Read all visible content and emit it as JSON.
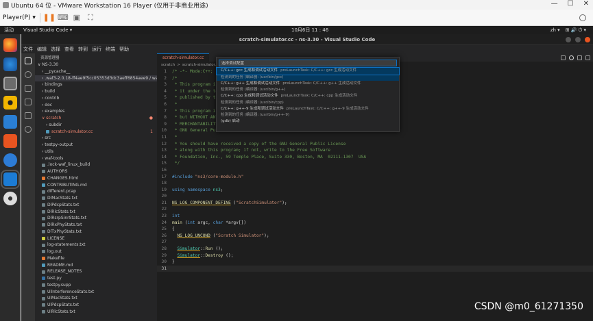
{
  "vm": {
    "title": "Ubuntu 64 位 - VMware Workstation 16 Player (仅用于非商业用途)",
    "player_menu": "Player(P) ▾",
    "minimize": "—",
    "maximize": "☐",
    "close": "✕"
  },
  "ubuntu": {
    "activities": "活动",
    "app_name": "Visual Studio Code ▾",
    "clock": "10月6日 11 : 46",
    "lang": "zh ▾",
    "sys_icons": "⊞ 🔊 ⏻ ▾"
  },
  "dock": [
    "firefox-icon",
    "thunderbird-icon",
    "files-icon",
    "rhythmbox-icon",
    "writer-icon",
    "software-icon",
    "help-icon",
    "vscode-icon",
    "disc-icon"
  ],
  "vscode": {
    "title": "scratch-simulator.cc - ns-3.30 - Visual Studio Code",
    "menu": [
      "文件",
      "编辑",
      "选择",
      "查看",
      "转到",
      "运行",
      "终端",
      "帮助"
    ],
    "explorer_header": "资源管理器",
    "tab_label": "scratch-simulator.cc",
    "breadcrumb": [
      "scratch",
      ">",
      "scratch-simulator.cc"
    ],
    "tree": [
      {
        "label": "∨ NS-3.30",
        "indent": 0,
        "color": "#cccccc",
        "icon": "",
        "mark": ""
      },
      {
        "label": "› __pycache__",
        "indent": 6,
        "color": "#cccccc",
        "icon": "",
        "mark": ""
      },
      {
        "label": "› .waf3-2.0.18-ff4ae9f5cc05353d3dc3aeff6854aee9 / waflib",
        "indent": 6,
        "color": "#cccccc",
        "icon": "",
        "mark": "",
        "selected": true
      },
      {
        "label": "› bindings",
        "indent": 6,
        "color": "#cccccc",
        "icon": "",
        "mark": ""
      },
      {
        "label": "› build",
        "indent": 6,
        "color": "#cccccc",
        "icon": "",
        "mark": ""
      },
      {
        "label": "› contrib",
        "indent": 6,
        "color": "#cccccc",
        "icon": "",
        "mark": ""
      },
      {
        "label": "› doc",
        "indent": 6,
        "color": "#cccccc",
        "icon": "",
        "mark": ""
      },
      {
        "label": "› examples",
        "indent": 6,
        "color": "#cccccc",
        "icon": "",
        "mark": ""
      },
      {
        "label": "∨ scratch",
        "indent": 6,
        "color": "#f48771",
        "icon": "",
        "mark": "●"
      },
      {
        "label": "› subdir",
        "indent": 12,
        "color": "#cccccc",
        "icon": "",
        "mark": ""
      },
      {
        "label": "scratch-simulator.cc",
        "indent": 12,
        "color": "#f48771",
        "icon": "#519aba",
        "mark": "1"
      },
      {
        "label": "› src",
        "indent": 6,
        "color": "#cccccc",
        "icon": "",
        "mark": ""
      },
      {
        "label": "› testpy-output",
        "indent": 6,
        "color": "#cccccc",
        "icon": "",
        "mark": ""
      },
      {
        "label": "› utils",
        "indent": 6,
        "color": "#cccccc",
        "icon": "",
        "mark": ""
      },
      {
        "label": "› waf-tools",
        "indent": 6,
        "color": "#cccccc",
        "icon": "",
        "mark": ""
      },
      {
        "label": ".lock-waf_linux_build",
        "indent": 6,
        "color": "#cccccc",
        "icon": "#6d8086",
        "mark": ""
      },
      {
        "label": "AUTHORS",
        "indent": 6,
        "color": "#cccccc",
        "icon": "#6d8086",
        "mark": ""
      },
      {
        "label": "CHANGES.html",
        "indent": 6,
        "color": "#cccccc",
        "icon": "#e37933",
        "mark": ""
      },
      {
        "label": "CONTRIBUTING.md",
        "indent": 6,
        "color": "#cccccc",
        "icon": "#519aba",
        "mark": ""
      },
      {
        "label": "different.pcap",
        "indent": 6,
        "color": "#cccccc",
        "icon": "#6d8086",
        "mark": ""
      },
      {
        "label": "DlMacStats.txt",
        "indent": 6,
        "color": "#cccccc",
        "icon": "#6d8086",
        "mark": ""
      },
      {
        "label": "DlPdcpStats.txt",
        "indent": 6,
        "color": "#cccccc",
        "icon": "#6d8086",
        "mark": ""
      },
      {
        "label": "DlRlcStats.txt",
        "indent": 6,
        "color": "#cccccc",
        "icon": "#6d8086",
        "mark": ""
      },
      {
        "label": "DlRsrpSinrStats.txt",
        "indent": 6,
        "color": "#cccccc",
        "icon": "#6d8086",
        "mark": ""
      },
      {
        "label": "DlRxPhyStats.txt",
        "indent": 6,
        "color": "#cccccc",
        "icon": "#6d8086",
        "mark": ""
      },
      {
        "label": "DlTxPhyStats.txt",
        "indent": 6,
        "color": "#cccccc",
        "icon": "#6d8086",
        "mark": ""
      },
      {
        "label": "LICENSE",
        "indent": 6,
        "color": "#cccccc",
        "icon": "#cbcb41",
        "mark": ""
      },
      {
        "label": "log-statements.txt",
        "indent": 6,
        "color": "#cccccc",
        "icon": "#6d8086",
        "mark": ""
      },
      {
        "label": "log.out",
        "indent": 6,
        "color": "#cccccc",
        "icon": "#6d8086",
        "mark": ""
      },
      {
        "label": "Makefile",
        "indent": 6,
        "color": "#cccccc",
        "icon": "#e37933",
        "mark": ""
      },
      {
        "label": "README.md",
        "indent": 6,
        "color": "#cccccc",
        "icon": "#519aba",
        "mark": ""
      },
      {
        "label": "RELEASE_NOTES",
        "indent": 6,
        "color": "#cccccc",
        "icon": "#6d8086",
        "mark": ""
      },
      {
        "label": "test.py",
        "indent": 6,
        "color": "#cccccc",
        "icon": "#3572a5",
        "mark": ""
      },
      {
        "label": "testpy.supp",
        "indent": 6,
        "color": "#cccccc",
        "icon": "#6d8086",
        "mark": ""
      },
      {
        "label": "UlInterferenceStats.txt",
        "indent": 6,
        "color": "#cccccc",
        "icon": "#6d8086",
        "mark": ""
      },
      {
        "label": "UlMacStats.txt",
        "indent": 6,
        "color": "#cccccc",
        "icon": "#6d8086",
        "mark": ""
      },
      {
        "label": "UlPdcpStats.txt",
        "indent": 6,
        "color": "#cccccc",
        "icon": "#6d8086",
        "mark": ""
      },
      {
        "label": "UlRlcStats.txt",
        "indent": 6,
        "color": "#cccccc",
        "icon": "#6d8086",
        "mark": ""
      }
    ],
    "code": [
      {
        "n": "1",
        "cls": "cm",
        "t": "/* -*- Mode:C++; c-file-style:\"gnu\"; indent-tabs-mode:nil; -*- */"
      },
      {
        "n": "2",
        "cls": "cm",
        "t": "/*"
      },
      {
        "n": "3",
        "cls": "cm",
        "t": " * This program is free software; you can redistribute it and/or modify"
      },
      {
        "n": "4",
        "cls": "cm",
        "t": " * it under the terms of the GNU General Public License version 2 as"
      },
      {
        "n": "5",
        "cls": "cm",
        "t": " * published by the Free Software Foundation;"
      },
      {
        "n": "6",
        "cls": "cm",
        "t": " *"
      },
      {
        "n": "7",
        "cls": "cm",
        "t": " * This program is distributed in the hope that it will be useful,"
      },
      {
        "n": "8",
        "cls": "cm",
        "t": " * but WITHOUT ANY WARRANTY; without even the implied warranty of"
      },
      {
        "n": "9",
        "cls": "cm",
        "t": " * MERCHANTABILITY or FITNESS FOR A PARTICULAR PURPOSE.  See the"
      },
      {
        "n": "10",
        "cls": "cm",
        "t": " * GNU General Public License for more details."
      },
      {
        "n": "11",
        "cls": "cm",
        "t": " *"
      },
      {
        "n": "12",
        "cls": "cm",
        "t": " * You should have received a copy of the GNU General Public License"
      },
      {
        "n": "13",
        "cls": "cm",
        "t": " * along with this program; if not, write to the Free Software"
      },
      {
        "n": "14",
        "cls": "cm",
        "t": " * Foundation, Inc., 59 Temple Place, Suite 330, Boston, MA  02111-1307  USA"
      },
      {
        "n": "15",
        "cls": "cm",
        "t": " */"
      },
      {
        "n": "16",
        "cls": "pl",
        "t": ""
      },
      {
        "n": "17",
        "cls": "mix",
        "parts": [
          [
            "kw",
            "#include "
          ],
          [
            "st",
            "\"ns3/core-module.h\""
          ]
        ]
      },
      {
        "n": "18",
        "cls": "pl",
        "t": ""
      },
      {
        "n": "19",
        "cls": "mix",
        "parts": [
          [
            "kw",
            "using namespace "
          ],
          [
            "ty",
            "ns3"
          ],
          [
            "pl",
            ";"
          ]
        ]
      },
      {
        "n": "20",
        "cls": "pl",
        "t": ""
      },
      {
        "n": "21",
        "cls": "mix",
        "parts": [
          [
            "fnu",
            "NS_LOG_COMPONENT_DEFINE"
          ],
          [
            "pl",
            " ("
          ],
          [
            "st",
            "\"ScratchSimulator\""
          ],
          [
            "pl",
            ");"
          ]
        ]
      },
      {
        "n": "22",
        "cls": "pl",
        "t": ""
      },
      {
        "n": "23",
        "cls": "kw",
        "t": "int"
      },
      {
        "n": "24",
        "cls": "mix",
        "parts": [
          [
            "fn",
            "main"
          ],
          [
            "pl",
            " ("
          ],
          [
            "kw",
            "int"
          ],
          [
            "pl",
            " argc, "
          ],
          [
            "kw",
            "char"
          ],
          [
            "pl",
            " *argv[])"
          ]
        ]
      },
      {
        "n": "25",
        "cls": "pl",
        "t": "{"
      },
      {
        "n": "26",
        "cls": "mix",
        "parts": [
          [
            "pl",
            "  "
          ],
          [
            "fnu",
            "NS_LOG_UNCOND"
          ],
          [
            "pl",
            " ("
          ],
          [
            "st",
            "\"Scratch Simulator\""
          ],
          [
            "pl",
            ");"
          ]
        ]
      },
      {
        "n": "27",
        "cls": "pl",
        "t": ""
      },
      {
        "n": "28",
        "cls": "mix",
        "parts": [
          [
            "pl",
            "  "
          ],
          [
            "tyu",
            "Simulator"
          ],
          [
            "pl",
            "::"
          ],
          [
            "fn",
            "Run"
          ],
          [
            "pl",
            " ();"
          ]
        ]
      },
      {
        "n": "29",
        "cls": "mix",
        "parts": [
          [
            "pl",
            "  "
          ],
          [
            "tyu",
            "Simulator"
          ],
          [
            "pl",
            "::"
          ],
          [
            "fn",
            "Destroy"
          ],
          [
            "pl",
            " ();"
          ]
        ]
      },
      {
        "n": "30",
        "cls": "pl",
        "t": "}"
      },
      {
        "n": "31",
        "cls": "pl",
        "t": "",
        "current": true
      }
    ],
    "quickpick": {
      "placeholder": "选择调试配置",
      "items": [
        {
          "label": "C/C++: gcc 生成和调试活动文件",
          "detail": "preLaunchTask: C/C++: gcc 生成活动文件",
          "desc": "检测到的任务 (编译器: /usr/bin/gcc)",
          "selected": true
        },
        {
          "label": "C/C++: g++ 生成和调试活动文件",
          "detail": "preLaunchTask: C/C++: g++ 生成活动文件",
          "desc": "检测到的任务 (编译器: /usr/bin/g++)"
        },
        {
          "label": "C/C++: cpp 生成和调试活动文件",
          "detail": "preLaunchTask: C/C++: cpp 生成活动文件",
          "desc": "检测到的任务 (编译器: /usr/bin/cpp)"
        },
        {
          "label": "C/C++: g++-9 生成和调试活动文件",
          "detail": "preLaunchTask: C/C++: g++-9 生成活动文件",
          "desc": "检测到的任务 (编译器: /usr/bin/g++-9)"
        },
        {
          "label": "(gdb) 启动",
          "detail": "",
          "desc": ""
        }
      ]
    }
  },
  "watermark": "CSDN @m0_61271350"
}
